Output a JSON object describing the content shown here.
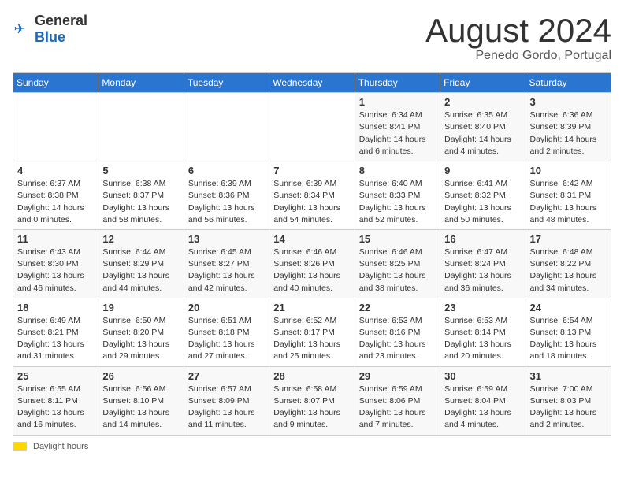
{
  "header": {
    "logo_general": "General",
    "logo_blue": "Blue",
    "month_title": "August 2024",
    "location": "Penedo Gordo, Portugal"
  },
  "days_of_week": [
    "Sunday",
    "Monday",
    "Tuesday",
    "Wednesday",
    "Thursday",
    "Friday",
    "Saturday"
  ],
  "weeks": [
    [
      {
        "day": "",
        "info": ""
      },
      {
        "day": "",
        "info": ""
      },
      {
        "day": "",
        "info": ""
      },
      {
        "day": "",
        "info": ""
      },
      {
        "day": "1",
        "info": "Sunrise: 6:34 AM\nSunset: 8:41 PM\nDaylight: 14 hours\nand 6 minutes."
      },
      {
        "day": "2",
        "info": "Sunrise: 6:35 AM\nSunset: 8:40 PM\nDaylight: 14 hours\nand 4 minutes."
      },
      {
        "day": "3",
        "info": "Sunrise: 6:36 AM\nSunset: 8:39 PM\nDaylight: 14 hours\nand 2 minutes."
      }
    ],
    [
      {
        "day": "4",
        "info": "Sunrise: 6:37 AM\nSunset: 8:38 PM\nDaylight: 14 hours\nand 0 minutes."
      },
      {
        "day": "5",
        "info": "Sunrise: 6:38 AM\nSunset: 8:37 PM\nDaylight: 13 hours\nand 58 minutes."
      },
      {
        "day": "6",
        "info": "Sunrise: 6:39 AM\nSunset: 8:36 PM\nDaylight: 13 hours\nand 56 minutes."
      },
      {
        "day": "7",
        "info": "Sunrise: 6:39 AM\nSunset: 8:34 PM\nDaylight: 13 hours\nand 54 minutes."
      },
      {
        "day": "8",
        "info": "Sunrise: 6:40 AM\nSunset: 8:33 PM\nDaylight: 13 hours\nand 52 minutes."
      },
      {
        "day": "9",
        "info": "Sunrise: 6:41 AM\nSunset: 8:32 PM\nDaylight: 13 hours\nand 50 minutes."
      },
      {
        "day": "10",
        "info": "Sunrise: 6:42 AM\nSunset: 8:31 PM\nDaylight: 13 hours\nand 48 minutes."
      }
    ],
    [
      {
        "day": "11",
        "info": "Sunrise: 6:43 AM\nSunset: 8:30 PM\nDaylight: 13 hours\nand 46 minutes."
      },
      {
        "day": "12",
        "info": "Sunrise: 6:44 AM\nSunset: 8:29 PM\nDaylight: 13 hours\nand 44 minutes."
      },
      {
        "day": "13",
        "info": "Sunrise: 6:45 AM\nSunset: 8:27 PM\nDaylight: 13 hours\nand 42 minutes."
      },
      {
        "day": "14",
        "info": "Sunrise: 6:46 AM\nSunset: 8:26 PM\nDaylight: 13 hours\nand 40 minutes."
      },
      {
        "day": "15",
        "info": "Sunrise: 6:46 AM\nSunset: 8:25 PM\nDaylight: 13 hours\nand 38 minutes."
      },
      {
        "day": "16",
        "info": "Sunrise: 6:47 AM\nSunset: 8:24 PM\nDaylight: 13 hours\nand 36 minutes."
      },
      {
        "day": "17",
        "info": "Sunrise: 6:48 AM\nSunset: 8:22 PM\nDaylight: 13 hours\nand 34 minutes."
      }
    ],
    [
      {
        "day": "18",
        "info": "Sunrise: 6:49 AM\nSunset: 8:21 PM\nDaylight: 13 hours\nand 31 minutes."
      },
      {
        "day": "19",
        "info": "Sunrise: 6:50 AM\nSunset: 8:20 PM\nDaylight: 13 hours\nand 29 minutes."
      },
      {
        "day": "20",
        "info": "Sunrise: 6:51 AM\nSunset: 8:18 PM\nDaylight: 13 hours\nand 27 minutes."
      },
      {
        "day": "21",
        "info": "Sunrise: 6:52 AM\nSunset: 8:17 PM\nDaylight: 13 hours\nand 25 minutes."
      },
      {
        "day": "22",
        "info": "Sunrise: 6:53 AM\nSunset: 8:16 PM\nDaylight: 13 hours\nand 23 minutes."
      },
      {
        "day": "23",
        "info": "Sunrise: 6:53 AM\nSunset: 8:14 PM\nDaylight: 13 hours\nand 20 minutes."
      },
      {
        "day": "24",
        "info": "Sunrise: 6:54 AM\nSunset: 8:13 PM\nDaylight: 13 hours\nand 18 minutes."
      }
    ],
    [
      {
        "day": "25",
        "info": "Sunrise: 6:55 AM\nSunset: 8:11 PM\nDaylight: 13 hours\nand 16 minutes."
      },
      {
        "day": "26",
        "info": "Sunrise: 6:56 AM\nSunset: 8:10 PM\nDaylight: 13 hours\nand 14 minutes."
      },
      {
        "day": "27",
        "info": "Sunrise: 6:57 AM\nSunset: 8:09 PM\nDaylight: 13 hours\nand 11 minutes."
      },
      {
        "day": "28",
        "info": "Sunrise: 6:58 AM\nSunset: 8:07 PM\nDaylight: 13 hours\nand 9 minutes."
      },
      {
        "day": "29",
        "info": "Sunrise: 6:59 AM\nSunset: 8:06 PM\nDaylight: 13 hours\nand 7 minutes."
      },
      {
        "day": "30",
        "info": "Sunrise: 6:59 AM\nSunset: 8:04 PM\nDaylight: 13 hours\nand 4 minutes."
      },
      {
        "day": "31",
        "info": "Sunrise: 7:00 AM\nSunset: 8:03 PM\nDaylight: 13 hours\nand 2 minutes."
      }
    ]
  ],
  "legend": {
    "daylight_label": "Daylight hours"
  }
}
